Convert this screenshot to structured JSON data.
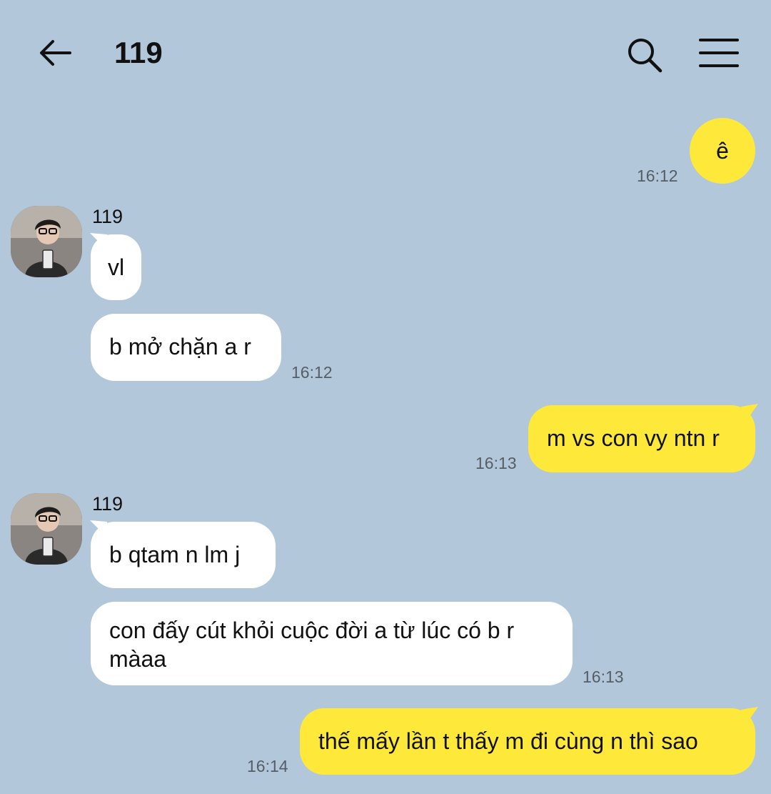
{
  "header": {
    "back_icon": "arrow-left-icon",
    "title": "119",
    "search_icon": "search-icon",
    "menu_icon": "hamburger-menu-icon"
  },
  "colors": {
    "background": "#b2c7da",
    "outgoing_bubble": "#fee93a",
    "incoming_bubble": "#ffffff"
  },
  "messages": [
    {
      "direction": "out",
      "text": "ê",
      "time": "16:12"
    },
    {
      "direction": "in",
      "sender": "119",
      "text": "vl"
    },
    {
      "direction": "in",
      "text": "b mở chặn a r",
      "time": "16:12"
    },
    {
      "direction": "out",
      "text": "m vs con vy ntn r",
      "time": "16:13"
    },
    {
      "direction": "in",
      "sender": "119",
      "text": "b qtam n lm j"
    },
    {
      "direction": "in",
      "text": "con đấy cút khỏi cuộc đời a từ lúc có b r màaa",
      "time": "16:13"
    },
    {
      "direction": "out",
      "text": "thế mấy lần t thấy m đi cùng n thì sao",
      "time": "16:14"
    }
  ]
}
